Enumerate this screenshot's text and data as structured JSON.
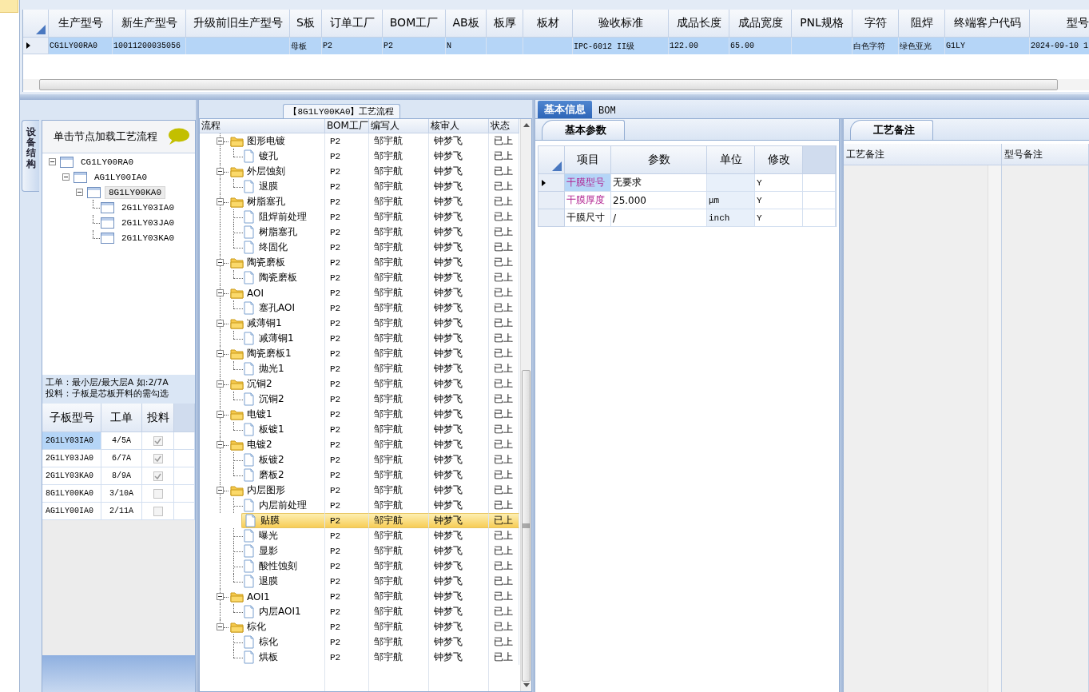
{
  "top_grid": {
    "columns": [
      "生产型号",
      "新生产型号",
      "升级前旧生产型号",
      "S板",
      "订单工厂",
      "BOM工厂",
      "AB板",
      "板厚",
      "板材",
      "验收标准",
      "成品长度",
      "成品宽度",
      "PNL规格",
      "字符",
      "阻焊",
      "终端客户代码",
      "型号"
    ],
    "rows": [
      {
        "selected": true,
        "cells": [
          "CG1LY00RA0",
          "10011200035056",
          null,
          "母板",
          "P2",
          "P2",
          "N",
          null,
          null,
          "IPC-6012 II级",
          "122.00",
          "65.00",
          null,
          "白色字符",
          "绿色亚光",
          "G1LY",
          "2024-09-10 1"
        ]
      }
    ]
  },
  "side_tab": {
    "label": "设备结构"
  },
  "structure_panel": {
    "title": "单击节点加载工艺流程",
    "tree": [
      {
        "label": "CG1LY00RA0",
        "expanded": true,
        "selected": false,
        "children": [
          {
            "label": "AG1LY00IA0",
            "expanded": true,
            "selected": false,
            "children": [
              {
                "label": "8G1LY00KA0",
                "expanded": true,
                "selected": true,
                "children": [
                  {
                    "label": "2G1LY03IA0",
                    "selected": false
                  },
                  {
                    "label": "2G1LY03JA0",
                    "selected": false
                  },
                  {
                    "label": "2G1LY03KA0",
                    "selected": false
                  }
                ]
              }
            ]
          }
        ]
      }
    ],
    "notes": [
      "工单：最小层/最大层A 如:2/7A",
      "投料：子板是芯板开料的需勾选"
    ],
    "sub_grid": {
      "columns": [
        "子板型号",
        "工单",
        "投料"
      ],
      "rows": [
        {
          "board": "2G1LY03IA0",
          "order": "4/5A",
          "feed": true,
          "selected": true
        },
        {
          "board": "2G1LY03JA0",
          "order": "6/7A",
          "feed": true,
          "selected": false
        },
        {
          "board": "2G1LY03KA0",
          "order": "8/9A",
          "feed": true,
          "selected": false
        },
        {
          "board": "8G1LY00KA0",
          "order": "3/10A",
          "feed": false,
          "selected": false
        },
        {
          "board": "AG1LY00IA0",
          "order": "2/11A",
          "feed": false,
          "selected": false
        }
      ]
    }
  },
  "process_panel": {
    "title": "【8G1LY00KA0】工艺流程",
    "columns": [
      "流程",
      "BOM工厂",
      "编写人",
      "核审人",
      "状态"
    ],
    "steps": [
      {
        "name": "图形电镀",
        "factory": "P2",
        "writer": "邹宇航",
        "reviewer": "钟梦飞",
        "status": "已上",
        "expanded": true,
        "selected": false,
        "children": [
          {
            "name": "镀孔",
            "factory": "P2",
            "writer": "邹宇航",
            "reviewer": "钟梦飞",
            "status": "已上",
            "selected": false
          }
        ]
      },
      {
        "name": "外层蚀刻",
        "factory": "P2",
        "writer": "邹宇航",
        "reviewer": "钟梦飞",
        "status": "已上",
        "expanded": true,
        "selected": false,
        "children": [
          {
            "name": "退膜",
            "factory": "P2",
            "writer": "邹宇航",
            "reviewer": "钟梦飞",
            "status": "已上",
            "selected": false
          }
        ]
      },
      {
        "name": "树脂塞孔",
        "factory": "P2",
        "writer": "邹宇航",
        "reviewer": "钟梦飞",
        "status": "已上",
        "expanded": true,
        "selected": false,
        "children": [
          {
            "name": "阻焊前处理",
            "factory": "P2",
            "writer": "邹宇航",
            "reviewer": "钟梦飞",
            "status": "已上",
            "selected": false
          },
          {
            "name": "树脂塞孔",
            "factory": "P2",
            "writer": "邹宇航",
            "reviewer": "钟梦飞",
            "status": "已上",
            "selected": false
          },
          {
            "name": "终固化",
            "factory": "P2",
            "writer": "邹宇航",
            "reviewer": "钟梦飞",
            "status": "已上",
            "selected": false
          }
        ]
      },
      {
        "name": "陶瓷磨板",
        "factory": "P2",
        "writer": "邹宇航",
        "reviewer": "钟梦飞",
        "status": "已上",
        "expanded": true,
        "selected": false,
        "children": [
          {
            "name": "陶瓷磨板",
            "factory": "P2",
            "writer": "邹宇航",
            "reviewer": "钟梦飞",
            "status": "已上",
            "selected": false
          }
        ]
      },
      {
        "name": "AOI",
        "factory": "P2",
        "writer": "邹宇航",
        "reviewer": "钟梦飞",
        "status": "已上",
        "expanded": true,
        "selected": false,
        "children": [
          {
            "name": "塞孔AOI",
            "factory": "P2",
            "writer": "邹宇航",
            "reviewer": "钟梦飞",
            "status": "已上",
            "selected": false
          }
        ]
      },
      {
        "name": "减薄铜1",
        "factory": "P2",
        "writer": "邹宇航",
        "reviewer": "钟梦飞",
        "status": "已上",
        "expanded": true,
        "selected": false,
        "children": [
          {
            "name": "减薄铜1",
            "factory": "P2",
            "writer": "邹宇航",
            "reviewer": "钟梦飞",
            "status": "已上",
            "selected": false
          }
        ]
      },
      {
        "name": "陶瓷磨板1",
        "factory": "P2",
        "writer": "邹宇航",
        "reviewer": "钟梦飞",
        "status": "已上",
        "expanded": true,
        "selected": false,
        "children": [
          {
            "name": "抛光1",
            "factory": "P2",
            "writer": "邹宇航",
            "reviewer": "钟梦飞",
            "status": "已上",
            "selected": false
          }
        ]
      },
      {
        "name": "沉铜2",
        "factory": "P2",
        "writer": "邹宇航",
        "reviewer": "钟梦飞",
        "status": "已上",
        "expanded": true,
        "selected": false,
        "children": [
          {
            "name": "沉铜2",
            "factory": "P2",
            "writer": "邹宇航",
            "reviewer": "钟梦飞",
            "status": "已上",
            "selected": false
          }
        ]
      },
      {
        "name": "电镀1",
        "factory": "P2",
        "writer": "邹宇航",
        "reviewer": "钟梦飞",
        "status": "已上",
        "expanded": true,
        "selected": false,
        "children": [
          {
            "name": "板镀1",
            "factory": "P2",
            "writer": "邹宇航",
            "reviewer": "钟梦飞",
            "status": "已上",
            "selected": false
          }
        ]
      },
      {
        "name": "电镀2",
        "factory": "P2",
        "writer": "邹宇航",
        "reviewer": "钟梦飞",
        "status": "已上",
        "expanded": true,
        "selected": false,
        "children": [
          {
            "name": "板镀2",
            "factory": "P2",
            "writer": "邹宇航",
            "reviewer": "钟梦飞",
            "status": "已上",
            "selected": false
          },
          {
            "name": "磨板2",
            "factory": "P2",
            "writer": "邹宇航",
            "reviewer": "钟梦飞",
            "status": "已上",
            "selected": false
          }
        ]
      },
      {
        "name": "内层图形",
        "factory": "P2",
        "writer": "邹宇航",
        "reviewer": "钟梦飞",
        "status": "已上",
        "expanded": true,
        "selected": false,
        "children": [
          {
            "name": "内层前处理",
            "factory": "P2",
            "writer": "邹宇航",
            "reviewer": "钟梦飞",
            "status": "已上",
            "selected": false
          },
          {
            "name": "贴膜",
            "factory": "P2",
            "writer": "邹宇航",
            "reviewer": "钟梦飞",
            "status": "已上",
            "selected": true
          },
          {
            "name": "曝光",
            "factory": "P2",
            "writer": "邹宇航",
            "reviewer": "钟梦飞",
            "status": "已上",
            "selected": false
          },
          {
            "name": "显影",
            "factory": "P2",
            "writer": "邹宇航",
            "reviewer": "钟梦飞",
            "status": "已上",
            "selected": false
          },
          {
            "name": "酸性蚀刻",
            "factory": "P2",
            "writer": "邹宇航",
            "reviewer": "钟梦飞",
            "status": "已上",
            "selected": false
          },
          {
            "name": "退膜",
            "factory": "P2",
            "writer": "邹宇航",
            "reviewer": "钟梦飞",
            "status": "已上",
            "selected": false
          }
        ]
      },
      {
        "name": "AOI1",
        "factory": "P2",
        "writer": "邹宇航",
        "reviewer": "钟梦飞",
        "status": "已上",
        "expanded": true,
        "selected": false,
        "children": [
          {
            "name": "内层AOI1",
            "factory": "P2",
            "writer": "邹宇航",
            "reviewer": "钟梦飞",
            "status": "已上",
            "selected": false
          }
        ]
      },
      {
        "name": "棕化",
        "factory": "P2",
        "writer": "邹宇航",
        "reviewer": "钟梦飞",
        "status": "已上",
        "expanded": true,
        "selected": false,
        "children": [
          {
            "name": "棕化",
            "factory": "P2",
            "writer": "邹宇航",
            "reviewer": "钟梦飞",
            "status": "已上",
            "selected": false
          },
          {
            "name": "烘板",
            "factory": "P2",
            "writer": "邹宇航",
            "reviewer": "钟梦飞",
            "status": "已上",
            "selected": false
          }
        ]
      }
    ]
  },
  "detail_panel": {
    "tabs": [
      {
        "label": "基本信息",
        "selected": true
      },
      {
        "label": "BOM",
        "selected": false
      }
    ],
    "params": {
      "tab": "基本参数",
      "columns": [
        "项目",
        "参数",
        "单位",
        "修改"
      ],
      "rows": [
        {
          "item": "干膜型号",
          "value": "无要求",
          "unit": null,
          "modify": "Y",
          "highlighted": true,
          "selected": true
        },
        {
          "item": "干膜厚度",
          "value": "25.000",
          "unit": "μm",
          "modify": "Y",
          "highlighted": true,
          "selected": false
        },
        {
          "item": "干膜尺寸",
          "value": "/",
          "unit": "inch",
          "modify": "Y",
          "highlighted": false,
          "selected": false
        }
      ]
    },
    "remarks": {
      "tab": "工艺备注",
      "columns": [
        "工艺备注",
        "型号备注"
      ]
    }
  }
}
